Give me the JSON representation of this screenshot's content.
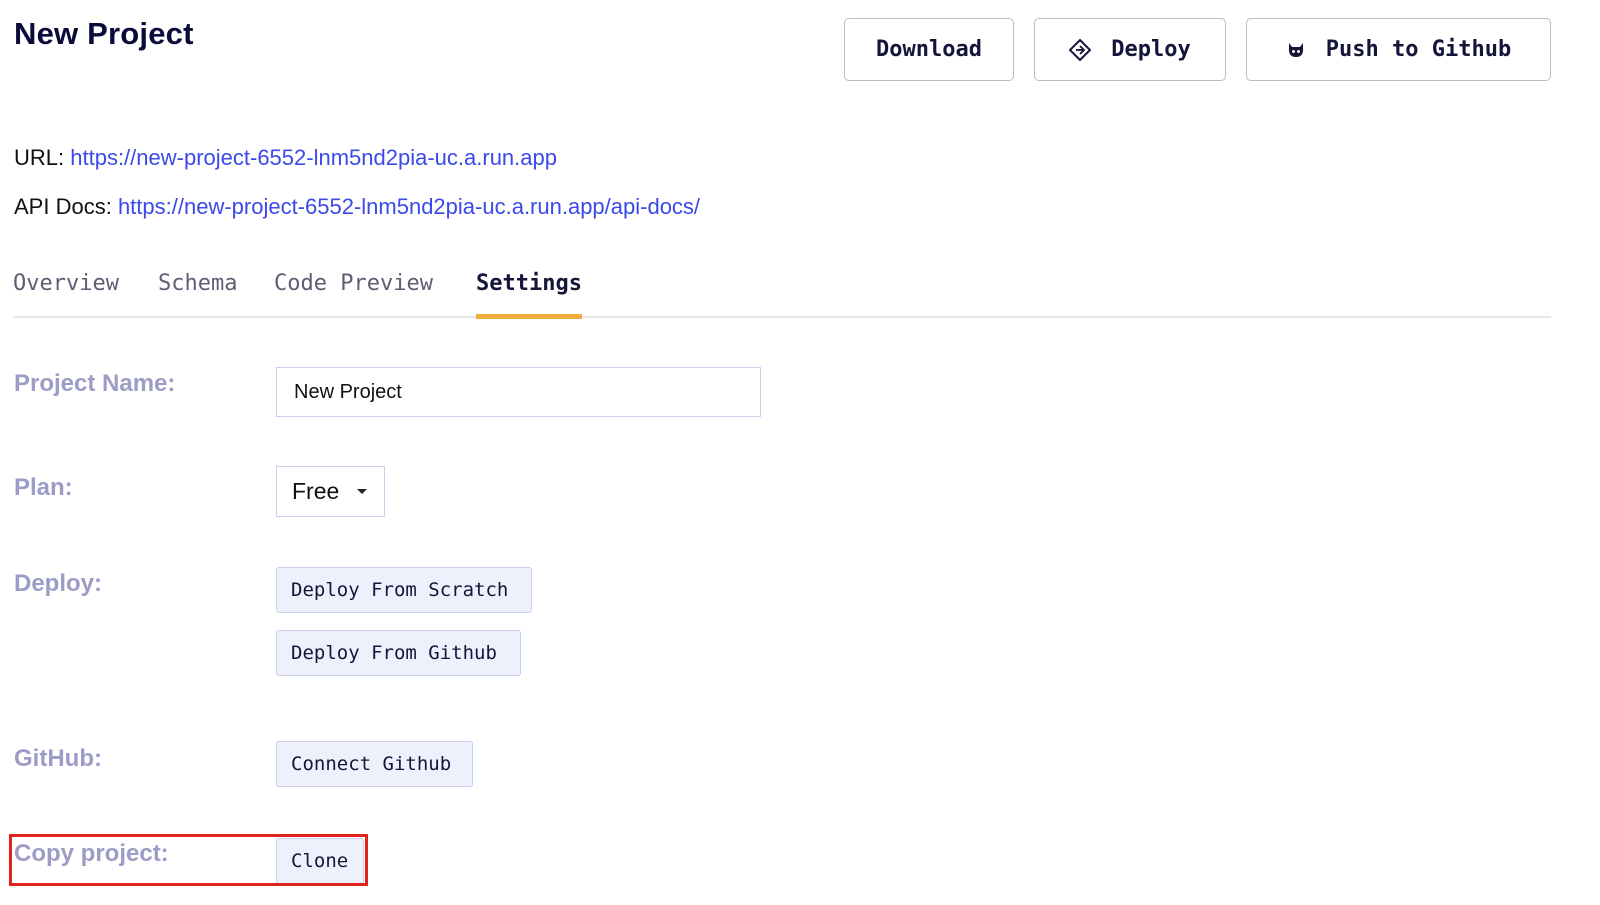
{
  "header": {
    "title": "New Project",
    "buttons": {
      "download": "Download",
      "deploy": "Deploy",
      "push": "Push to Github"
    }
  },
  "links": {
    "url_label": "URL:",
    "url": "https://new-project-6552-lnm5nd2pia-uc.a.run.app",
    "api_label": "API Docs:",
    "api_url": "https://new-project-6552-lnm5nd2pia-uc.a.run.app/api-docs/"
  },
  "tabs": [
    {
      "label": "Overview",
      "active": false
    },
    {
      "label": "Schema",
      "active": false
    },
    {
      "label": "Code Preview",
      "active": false
    },
    {
      "label": "Settings",
      "active": true
    }
  ],
  "settings": {
    "project_name_label": "Project Name:",
    "project_name_value": "New Project",
    "plan_label": "Plan:",
    "plan_value": "Free",
    "deploy_label": "Deploy:",
    "deploy_scratch": "Deploy From Scratch",
    "deploy_github": "Deploy From Github",
    "github_label": "GitHub:",
    "connect_github": "Connect Github",
    "copy_label": "Copy project:",
    "clone": "Clone"
  },
  "colors": {
    "accent_tab": "#f0ad3e",
    "link": "#3b49e8",
    "label": "#9c9cc6",
    "highlight": "#e0231b"
  }
}
